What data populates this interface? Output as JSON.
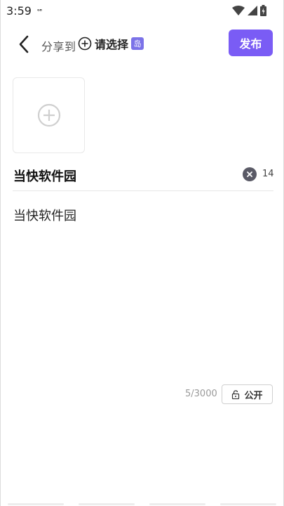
{
  "status_bar": {
    "time": "3:59",
    "sim_badge": "ᴳᴮ",
    "icons": [
      "wifi-icon",
      "signal-icon",
      "battery-icon"
    ]
  },
  "header": {
    "share_to_label": "分享到",
    "select_label": "请选择",
    "island_badge": "岛",
    "publish_label": "发布"
  },
  "editor": {
    "title_value": "当快软件园",
    "title_count": "14",
    "body_value": "当快软件园"
  },
  "footer": {
    "char_count": "5/3000",
    "visibility_label": "公开"
  },
  "colors": {
    "accent": "#7a5cf5",
    "badge": "#7b72e8"
  }
}
